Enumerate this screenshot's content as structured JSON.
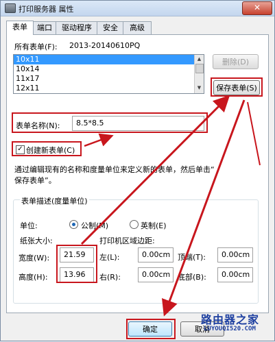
{
  "window": {
    "title": "打印服务器 属性",
    "close_glyph": "✕"
  },
  "tabs": [
    "表单",
    "端口",
    "驱动程序",
    "安全",
    "高级"
  ],
  "forms": {
    "all_forms_label": "所有表单(F):",
    "server_name": "2013-20140610PQ",
    "items": [
      "10x11",
      "10x14",
      "11x17",
      "12x11"
    ],
    "selected": "10x11",
    "delete_button": "删除(D)",
    "save_button": "保存表单(S)"
  },
  "form_name": {
    "label": "表单名称(N):",
    "value": "8.5*8.5"
  },
  "create_new": {
    "label": "创建新表单(C)",
    "checked": true,
    "check_glyph": "✓"
  },
  "hint": {
    "line1": "通过编辑现有的名称和度量单位来定义新的表单，然后单击“",
    "line2": "保存表单”。"
  },
  "description": {
    "group_label": "表单描述(度量单位)",
    "unit_label": "单位:",
    "metric_label": "公制(M)",
    "english_label": "英制(E)",
    "unit_selected": "metric",
    "paper_size_label": "纸张大小:",
    "margins_label": "打印机区域边距:",
    "width_label": "宽度(W):",
    "width_value": "21.59",
    "height_label": "高度(H):",
    "height_value": "13.96",
    "left_label": "左(L):",
    "left_value": "0.00cm",
    "right_label": "右(R):",
    "right_value": "0.00cm",
    "top_label": "顶端(T):",
    "top_value": "0.00cm",
    "bottom_label": "底部(B):",
    "bottom_value": "0.00cm"
  },
  "footer": {
    "ok_button": "确定",
    "cancel_button": "取消"
  },
  "watermark": {
    "main": "路由器之家",
    "sub": "LUYOUQI520.COM"
  },
  "colors": {
    "annotation_red": "#c8161d",
    "selection_blue": "#3399ff"
  }
}
